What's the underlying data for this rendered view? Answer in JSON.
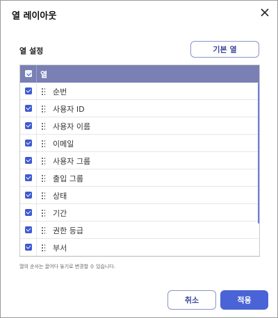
{
  "dialog": {
    "title": "열 레이아웃",
    "section_label": "열 설정",
    "default_button": "기본 열",
    "hint": "열의 순서는 끌어다 놓기로 변경할 수 있습니다.",
    "cancel_button": "취소",
    "apply_button": "적용"
  },
  "grid": {
    "header_label": "열",
    "rows": [
      {
        "label": "순번",
        "checked": true
      },
      {
        "label": "사용자 ID",
        "checked": true
      },
      {
        "label": "사용자 이름",
        "checked": true
      },
      {
        "label": "이메일",
        "checked": true
      },
      {
        "label": "사용자 그룹",
        "checked": true
      },
      {
        "label": "출입 그룹",
        "checked": true
      },
      {
        "label": "상태",
        "checked": true
      },
      {
        "label": "기간",
        "checked": true
      },
      {
        "label": "권한 등급",
        "checked": true
      },
      {
        "label": "부서",
        "checked": true
      }
    ]
  },
  "icons": {
    "close": "close-icon",
    "checkbox": "checkbox-checked-icon",
    "drag": "drag-handle-icon"
  },
  "colors": {
    "header_bg": "#7a7fb4",
    "accent": "#4a63d6",
    "checkbox": "#3e5bcf"
  }
}
